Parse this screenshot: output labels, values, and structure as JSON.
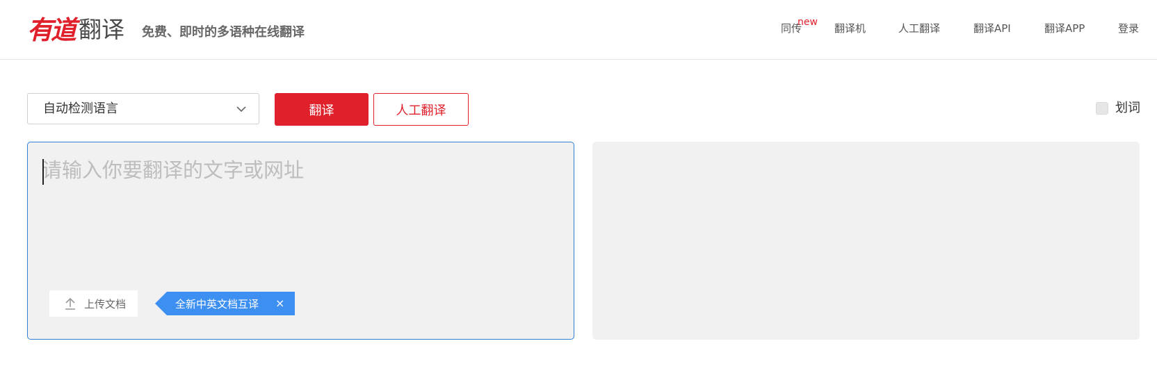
{
  "header": {
    "logo_red": "有道",
    "logo_gray": "翻译",
    "slogan": "免费、即时的多语种在线翻译",
    "nav": [
      {
        "label": "同传",
        "badge": "new"
      },
      {
        "label": "翻译机"
      },
      {
        "label": "人工翻译"
      },
      {
        "label": "翻译API"
      },
      {
        "label": "翻译APP"
      },
      {
        "label": "登录"
      }
    ]
  },
  "toolbar": {
    "language_select": "自动检测语言",
    "translate_button": "翻译",
    "human_translate_button": "人工翻译",
    "word_pick_label": "划词",
    "word_pick_checked": false
  },
  "input": {
    "placeholder": "请输入你要翻译的文字或网址",
    "value": "",
    "upload_label": "上传文档",
    "promo_label": "全新中英文档互译",
    "promo_close": "×"
  },
  "colors": {
    "brand_red": "#e0202b",
    "focus_blue": "#2f7fd5",
    "promo_blue": "#3d8ff2",
    "panel_bg": "#f1f1f1"
  },
  "icons": [
    "chevron-down-icon",
    "upload-icon",
    "close-icon"
  ]
}
